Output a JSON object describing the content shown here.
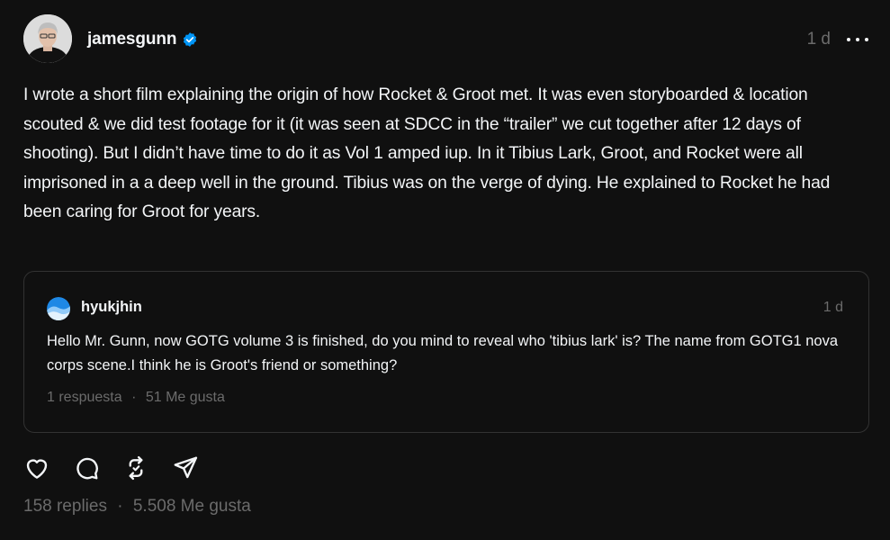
{
  "post": {
    "author": "jamesgunn",
    "verified": true,
    "time": "1 d",
    "more_icon": "more-horizontal-icon",
    "text": "I wrote a short film explaining the origin of how Rocket & Groot met. It was even storyboarded & location scouted & we did test footage for it (it was seen at SDCC in the “trailer” we cut together after 12 days of shooting). But I didn’t have time to do it as Vol 1 amped iup. In it Tibius Lark, Groot, and Rocket were all imprisoned in a a deep well in the ground. Tibius was on the verge of dying. He explained to Rocket he had been caring for Groot for years.",
    "replies": "158 replies",
    "likes": "5.508 Me gusta",
    "separator": "·"
  },
  "quoted": {
    "author": "hyukjhin",
    "time": "1 d",
    "text": "Hello Mr. Gunn, now GOTG volume 3 is finished, do you mind to reveal who 'tibius lark' is? The name from GOTG1 nova corps scene.I think he is Groot's friend or something?",
    "replies": "1 respuesta",
    "likes": "51 Me gusta",
    "separator": "·"
  },
  "actions": [
    {
      "name": "like",
      "icon": "heart-icon"
    },
    {
      "name": "reply",
      "icon": "comment-icon"
    },
    {
      "name": "repost",
      "icon": "repost-icon"
    },
    {
      "name": "share",
      "icon": "send-icon"
    }
  ],
  "colors": {
    "background": "#101010",
    "text": "#f3f5f7",
    "muted": "#6b6b6b",
    "border": "#323232",
    "verified": "#0095f6"
  }
}
